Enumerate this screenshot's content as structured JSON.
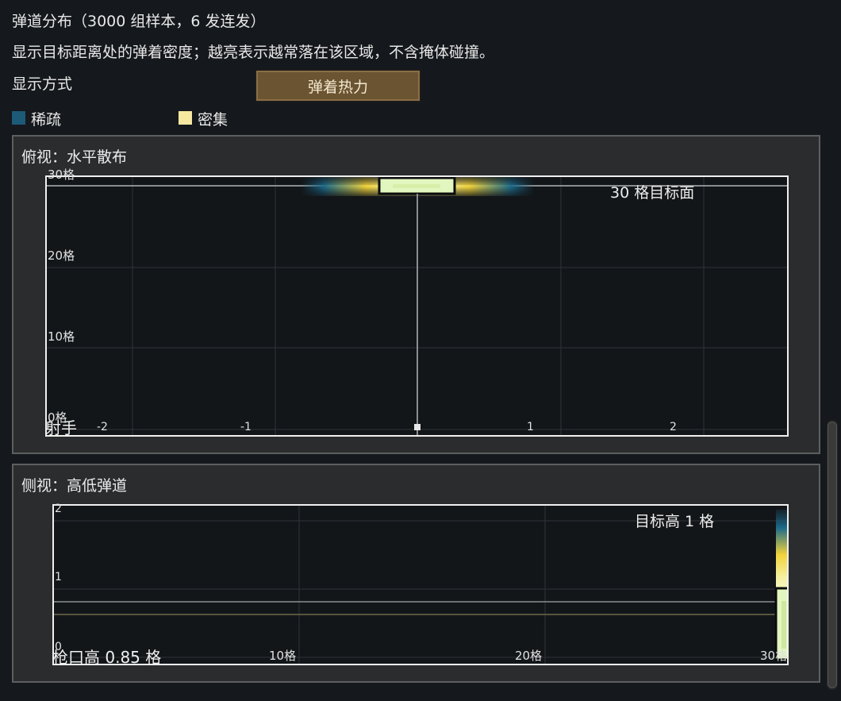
{
  "header": {
    "title": "弹道分布（3000 组样本，6 发连发）",
    "description": "显示目标距离处的弹着密度；越亮表示越常落在该区域，不含掩体碰撞。",
    "display_mode_label": "显示方式",
    "display_mode_button": "弹着热力"
  },
  "legend": {
    "sparse": {
      "label": "稀疏",
      "color": "#1c5a78"
    },
    "dense": {
      "label": "密集",
      "color": "#f6e8a0"
    }
  },
  "top_view": {
    "title": "俯视：水平散布",
    "annotation": "30 格目标面",
    "shooter_label": "射手",
    "y_ticks": [
      "0格",
      "10格",
      "20格",
      "30格"
    ],
    "x_ticks": [
      "-2",
      "-1",
      "1",
      "2"
    ]
  },
  "side_view": {
    "title": "侧视：高低弹道",
    "annotation": "目标高 1 格",
    "muzzle_label": "枪口高 0.85 格",
    "y_ticks": [
      "0",
      "1",
      "2"
    ],
    "x_ticks": [
      "10格",
      "20格",
      "30格"
    ]
  },
  "colors": {
    "background": "#15181c",
    "panel": "#2b2c2e",
    "button": "#6b5431",
    "heat_low": "#1c5a78",
    "heat_mid": "#f2d33a",
    "heat_high": "#f4f7c8"
  }
}
